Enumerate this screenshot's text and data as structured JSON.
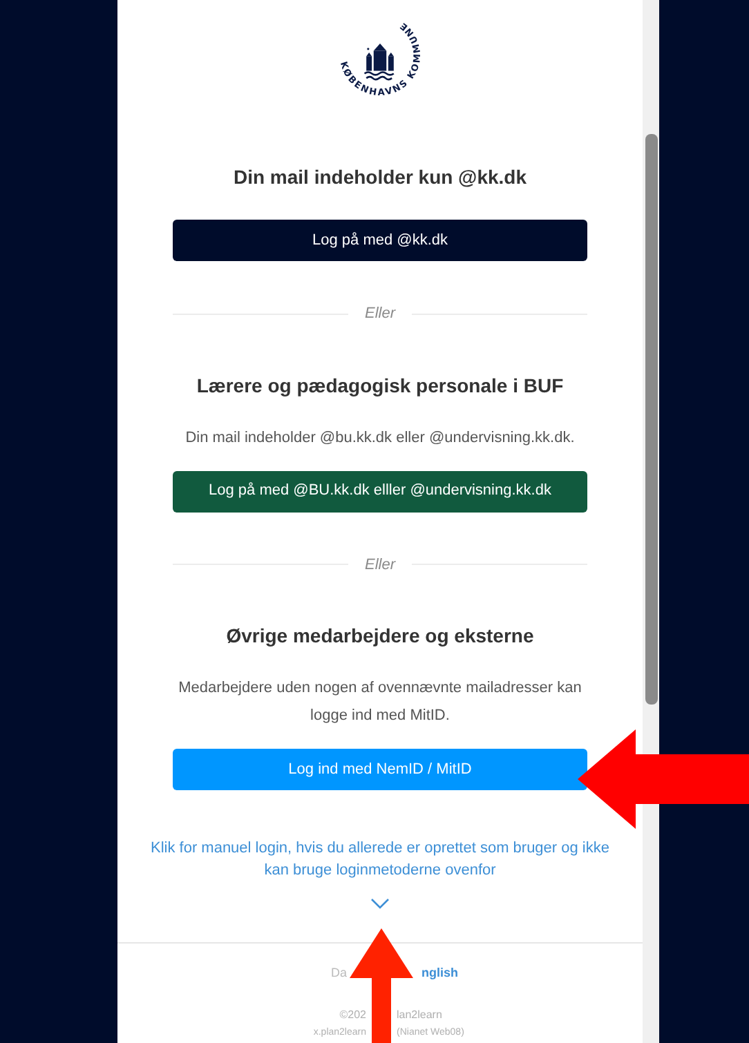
{
  "logo": {
    "text": "KØBENHAVNS KOMMUNE"
  },
  "sections": [
    {
      "heading": "Din mail indeholder kun @kk.dk",
      "button": {
        "label": "Log på med @kk.dk",
        "kind": "navy"
      }
    },
    {
      "divider": "Eller",
      "heading": "Lærere og pædagogisk personale i BUF",
      "description": "Din mail indeholder @bu.kk.dk eller @undervisning.kk.dk.",
      "button": {
        "label": "Log på med @BU.kk.dk elller @undervisning.kk.dk",
        "kind": "green"
      }
    },
    {
      "divider": "Eller",
      "heading": "Øvrige medarbejdere og eksterne",
      "description": "Medarbejdere uden nogen af ovennævnte mailadresser kan logge ind med MitID.",
      "button": {
        "label": "Log ind med NemID / MitID",
        "kind": "blue"
      }
    }
  ],
  "manual_login": {
    "label": "Klik for manuel login, hvis du allerede er oprettet som bruger og ikke kan bruge loginmetoderne ovenfor",
    "expanded": false
  },
  "footer": {
    "languages": [
      {
        "label": "Da",
        "selected": false
      },
      {
        "label": "nglish",
        "selected": true
      }
    ],
    "copyright": [
      "©202",
      "lan2learn"
    ],
    "server": [
      "x.plan2learn",
      "(Nianet Web08)"
    ]
  }
}
